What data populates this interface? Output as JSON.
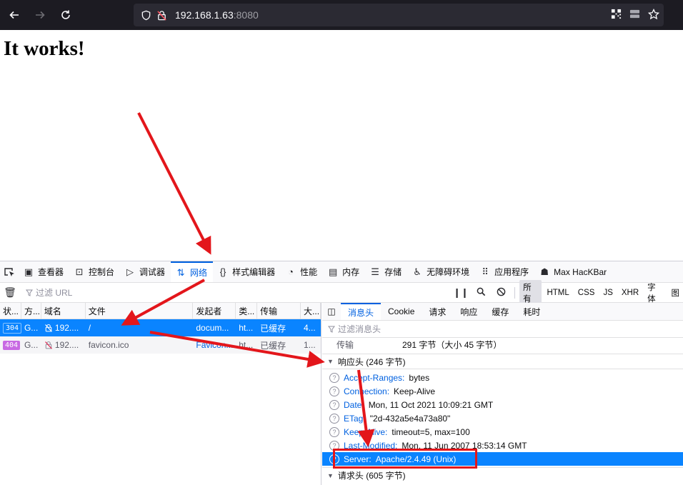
{
  "browser": {
    "url_host": "192.168.1.63",
    "url_port": ":8080"
  },
  "page": {
    "heading": "It works!"
  },
  "devtools": {
    "tabs": [
      {
        "label": "查看器",
        "icon": "inspector-icon"
      },
      {
        "label": "控制台",
        "icon": "console-icon"
      },
      {
        "label": "调试器",
        "icon": "debugger-icon"
      },
      {
        "label": "网络",
        "icon": "network-icon",
        "active": true
      },
      {
        "label": "样式编辑器",
        "icon": "style-editor-icon"
      },
      {
        "label": "性能",
        "icon": "performance-icon"
      },
      {
        "label": "内存",
        "icon": "memory-icon"
      },
      {
        "label": "存储",
        "icon": "storage-icon"
      },
      {
        "label": "无障碍环境",
        "icon": "accessibility-icon"
      },
      {
        "label": "应用程序",
        "icon": "application-icon"
      },
      {
        "label": "Max HacKBar",
        "icon": "hackbar-icon"
      }
    ],
    "filter_placeholder": "过滤 URL",
    "type_filters": [
      "所有",
      "HTML",
      "CSS",
      "JS",
      "XHR",
      "字体",
      "图"
    ],
    "columns": [
      "状...",
      "方...",
      "域名",
      "文件",
      "发起者",
      "类...",
      "传输",
      "大..."
    ],
    "requests": [
      {
        "status": "304",
        "method": "G...",
        "domain": "192....",
        "file": "/",
        "initiator": "docum...",
        "type": "ht...",
        "transferred": "已缓存",
        "size": "4..."
      },
      {
        "status": "404",
        "method": "G...",
        "domain": "192....",
        "file": "favicon.ico",
        "initiator": "Favicon...",
        "type": "ht...",
        "transferred": "已缓存",
        "size": "1..."
      }
    ],
    "side_tabs": [
      "消息头",
      "Cookie",
      "请求",
      "响应",
      "缓存",
      "耗时"
    ],
    "side_filter_placeholder": "过滤消息头",
    "transfer_label": "传输",
    "transfer_value": "291 字节（大小 45 字节）",
    "response_section": "响应头 (246 字节)",
    "response_headers": [
      {
        "name": "Accept-Ranges:",
        "value": "bytes"
      },
      {
        "name": "Connection:",
        "value": "Keep-Alive"
      },
      {
        "name": "Date:",
        "value": "Mon, 11 Oct 2021 10:09:21 GMT"
      },
      {
        "name": "ETag:",
        "value": "\"2d-432a5e4a73a80\""
      },
      {
        "name": "Keep-Alive:",
        "value": "timeout=5, max=100"
      },
      {
        "name": "Last-Modified:",
        "value": "Mon, 11 Jun 2007 18:53:14 GMT"
      },
      {
        "name": "Server:",
        "value": "Apache/2.4.49 (Unix)",
        "selected": true
      }
    ],
    "request_section": "请求头 (605 字节)"
  },
  "annotation": {
    "arrow_color": "#e3161b"
  }
}
